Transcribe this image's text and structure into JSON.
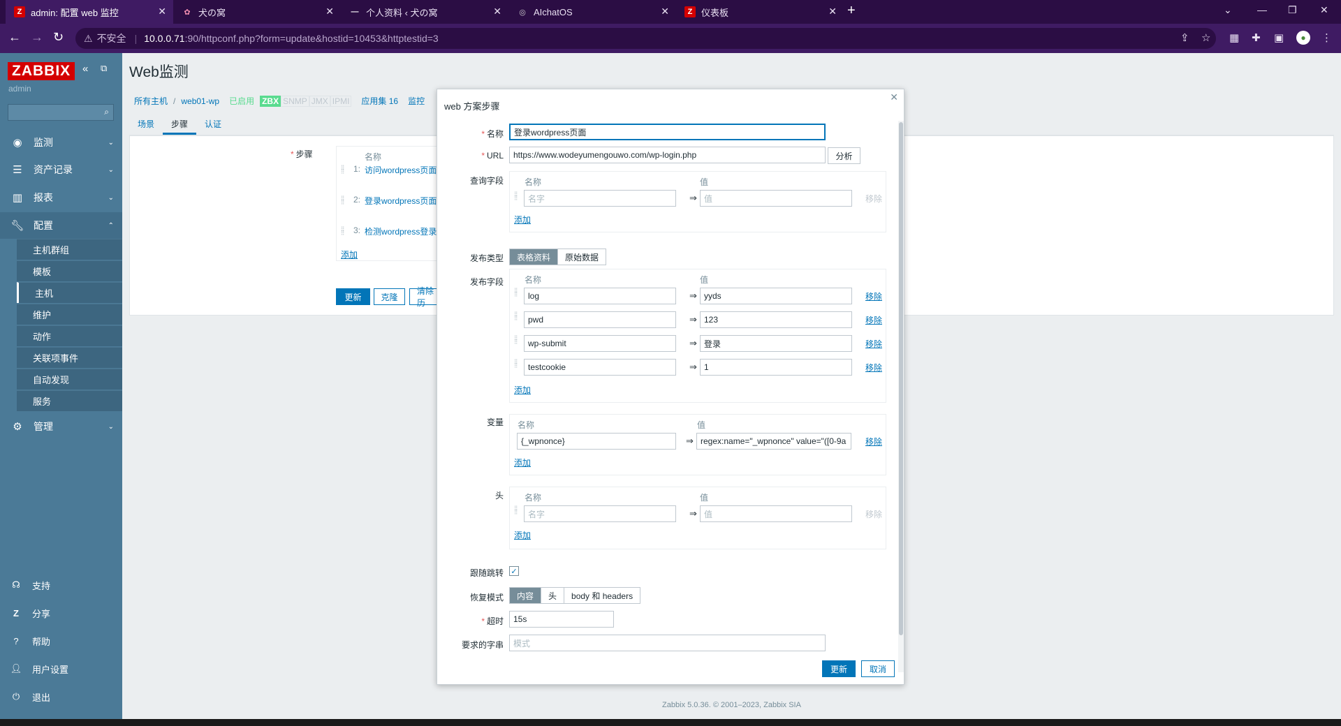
{
  "browser": {
    "tabs": [
      {
        "title": "admin: 配置 web 监控",
        "icon": "zabbix-icon"
      },
      {
        "title": "犬の窝",
        "icon": "flower-icon"
      },
      {
        "title": "个人资料 ‹ 犬の窝",
        "icon": "wordpress-icon"
      },
      {
        "title": "AIchatOS",
        "icon": "chat-icon"
      },
      {
        "title": "仪表板",
        "icon": "zabbix-icon"
      }
    ],
    "security": "不安全",
    "url_host": "10.0.0.71",
    "url_rest": ":90/httpconf.php?form=update&hostid=10453&httptestid=3"
  },
  "sidebar": {
    "logo": "ZABBIX",
    "user": "admin",
    "menu": [
      {
        "label": "监测",
        "icon": "eye-icon"
      },
      {
        "label": "资产记录",
        "icon": "list-icon"
      },
      {
        "label": "报表",
        "icon": "bar-chart-icon"
      },
      {
        "label": "配置",
        "icon": "wrench-icon"
      }
    ],
    "submenu": [
      "主机群组",
      "模板",
      "主机",
      "维护",
      "动作",
      "关联项事件",
      "自动发现",
      "服务"
    ],
    "admin": "管理",
    "bottom": [
      "支持",
      "分享",
      "帮助",
      "用户设置",
      "退出"
    ]
  },
  "main": {
    "title": "Web监测",
    "crumbs": [
      "所有主机",
      "/",
      "web01-wp",
      "已启用",
      "ZBX",
      "SNMP",
      "JMX",
      "IPMI",
      "应用集 16",
      "监控"
    ],
    "tabs": [
      "场景",
      "步骤",
      "认证"
    ],
    "steps_label": "步骤",
    "steps_col": "名称",
    "steps": [
      "1:",
      "访问wordpress页面",
      "2:",
      "登录wordpress页面",
      "3:",
      "检测wordpress登录"
    ],
    "add": "添加",
    "buttons": [
      "更新",
      "克隆",
      "清除历"
    ],
    "footer": "Zabbix 5.0.36. © 2001–2023, Zabbix SIA"
  },
  "modal": {
    "title": "web 方案步骤",
    "name_label": "名称",
    "name_value": "登录wordpress页面",
    "url_label": "URL",
    "url_value": "https://www.wodeyumengouwo.com/wp-login.php",
    "parse": "分析",
    "query_label": "查询字段",
    "col_name": "名称",
    "col_value": "值",
    "ph_name": "名字",
    "ph_value": "值",
    "remove": "移除",
    "add": "添加",
    "post_type_label": "发布类型",
    "post_types": [
      "表格资料",
      "原始数据"
    ],
    "post_fields_label": "发布字段",
    "post_fields": [
      {
        "name": "log",
        "value": "yyds"
      },
      {
        "name": "pwd",
        "value": "123"
      },
      {
        "name": "wp-submit",
        "value": "登录"
      },
      {
        "name": "testcookie",
        "value": "1"
      }
    ],
    "vars_label": "变量",
    "var_name": "{_wpnonce}",
    "var_value": "regex:name=\"_wpnonce\" value=\"([0-9a",
    "headers_label": "头",
    "follow_label": "跟随跳转",
    "retrieve_label": "恢复模式",
    "retrieve_modes": [
      "内容",
      "头",
      "body 和 headers"
    ],
    "timeout_label": "超时",
    "timeout_value": "15s",
    "required_label": "要求的字串",
    "required_ph": "模式",
    "update": "更新",
    "cancel": "取消"
  }
}
